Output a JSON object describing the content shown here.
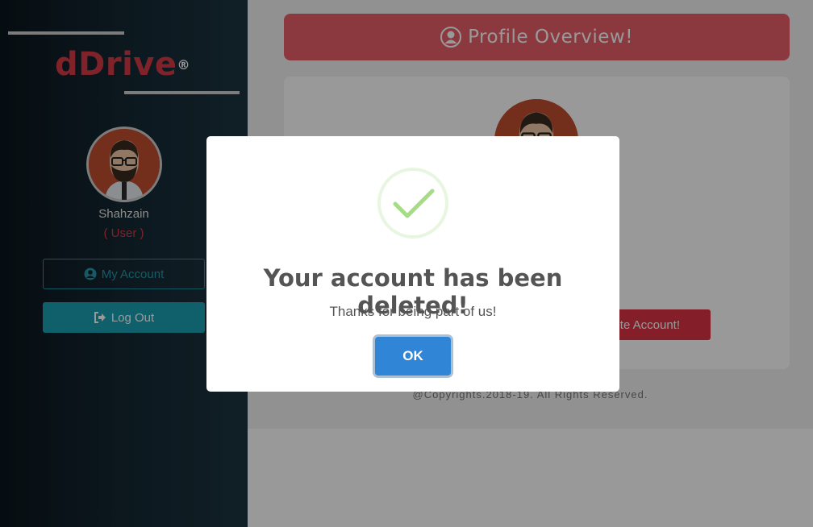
{
  "sidebar": {
    "brand": "dDrive",
    "brand_mark": "®",
    "user_name": "Shahzain",
    "user_role": "( User )",
    "my_account_label": "My Account",
    "logout_label": "Log Out"
  },
  "main": {
    "header_title": "Profile Overview!",
    "delete_account_label": "Delete Account!",
    "footer": "@Copyrights.2018-19. All Rights Reserved."
  },
  "modal": {
    "title": "Your account has been deleted!",
    "message": "Thanks for being part of us!",
    "ok_label": "OK"
  },
  "icons": {
    "header": "user-circle-icon",
    "my_account": "user-circle-icon",
    "logout": "sign-out-icon",
    "success": "checkmark-icon"
  },
  "colors": {
    "brand": "#d63a45",
    "accent": "#1aa0b3",
    "header": "#e8606a",
    "danger": "#dc3545",
    "ok_button": "#3085d6",
    "success": "#a5dc86"
  }
}
